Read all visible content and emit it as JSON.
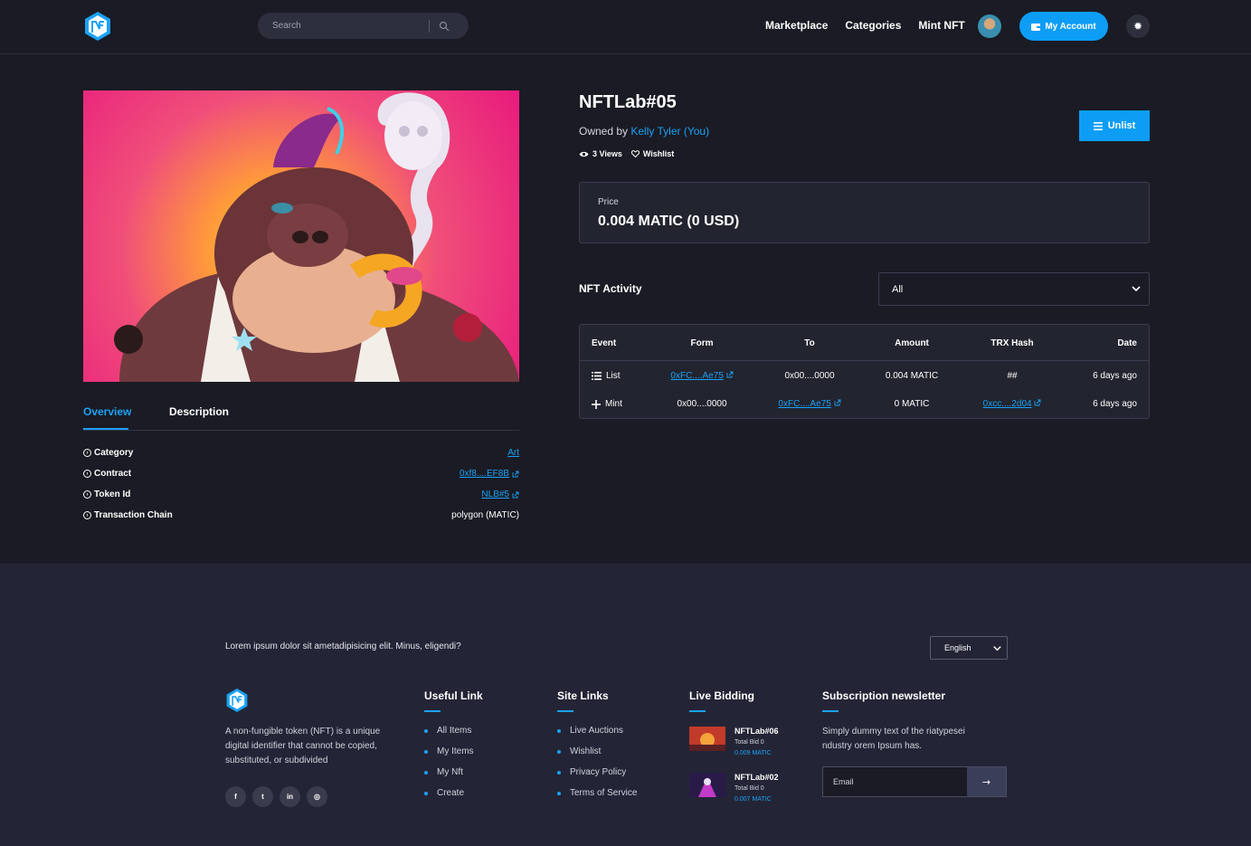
{
  "header": {
    "search_placeholder": "Search",
    "nav": [
      "Marketplace",
      "Categories",
      "Mint NFT"
    ],
    "account_label": "My Account"
  },
  "nft": {
    "title": "NFTLab#05",
    "owned_prefix": "Owned by",
    "owner": "Kelly Tyler (You)",
    "views": "3 Views",
    "wishlist": "Wishlist",
    "unlist_label": "Unlist",
    "price_label": "Price",
    "price_value": "0.004 MATIC (0 USD)"
  },
  "tabs": [
    "Overview",
    "Description"
  ],
  "overview": [
    {
      "key": "Category",
      "value": "Art",
      "link": true,
      "external": false
    },
    {
      "key": "Contract",
      "value": "0xf8....EF8B",
      "link": true,
      "external": true
    },
    {
      "key": "Token Id",
      "value": "NLB#5",
      "link": true,
      "external": true
    },
    {
      "key": "Transaction Chain",
      "value": "polygon (MATIC)",
      "link": false,
      "external": false
    }
  ],
  "activity": {
    "title": "NFT Activity",
    "filter_value": "All",
    "headers": [
      "Event",
      "Form",
      "To",
      "Amount",
      "TRX Hash",
      "Date"
    ],
    "rows": [
      {
        "event": "List",
        "event_icon": "list-icon",
        "form": "0xFC....Ae75",
        "to": "0x00....0000",
        "amount": "0.004 MATIC",
        "hash": "##",
        "date": "6 days ago"
      },
      {
        "event": "Mint",
        "event_icon": "plus-icon",
        "form": "0x00....0000",
        "to": "0xFC....Ae75",
        "amount": "0 MATIC",
        "hash": "0xcc....2d04",
        "date": "6 days ago"
      }
    ]
  },
  "footer": {
    "lorem": "Lorem ipsum dolor sit ametadipisicing elit. Minus, eligendi?",
    "language": "English",
    "about": "A non-fungible token (NFT) is a unique digital identifier that cannot be copied, substituted, or subdivided",
    "socials": [
      "facebook-icon",
      "twitter-icon",
      "linkedin-icon",
      "instagram-icon"
    ],
    "useful_title": "Useful Link",
    "useful_links": [
      "All Items",
      "My Items",
      "My Nft",
      "Create"
    ],
    "site_title": "Site Links",
    "site_links": [
      "Live Auctions",
      "Wishlist",
      "Privacy Policy",
      "Terms of Service"
    ],
    "bidding_title": "Live Bidding",
    "bids": [
      {
        "name": "NFTLab#06",
        "sub": "Total Bid 0",
        "price": "0.009 MATIC"
      },
      {
        "name": "NFTLab#02",
        "sub": "Total Bid 0",
        "price": "0.007 MATIC"
      }
    ],
    "news_title": "Subscription newsletter",
    "news_text": "Simply dummy text of the riatypesei ndustry orem Ipsum has.",
    "email_placeholder": "Email",
    "submit": "→"
  },
  "colors": {
    "accent": "#1ba2f5",
    "background": "#1a1b24",
    "footer": "#232536"
  }
}
